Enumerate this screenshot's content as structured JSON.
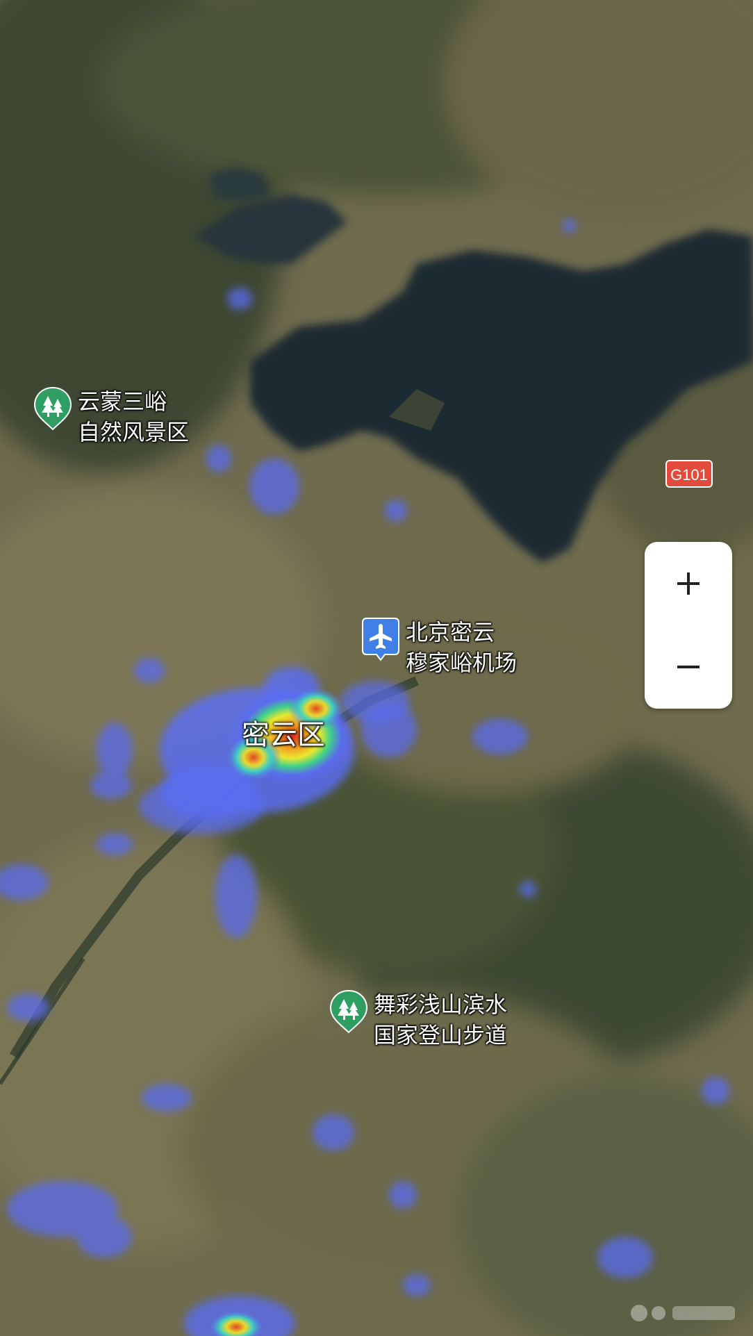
{
  "map": {
    "district_label": "密云区",
    "road_badge": "G101",
    "pois": [
      {
        "name": "scenic-area-yunmeng",
        "icon": "park-tree-icon",
        "lines": [
          "云蒙三峪",
          "自然风景区"
        ]
      },
      {
        "name": "airport-miyun",
        "icon": "airplane-icon",
        "lines": [
          "北京密云",
          "穆家峪机场"
        ]
      },
      {
        "name": "hiking-trail",
        "icon": "park-tree-icon",
        "lines": [
          "舞彩浅山滨水",
          "国家登山步道"
        ]
      }
    ]
  },
  "zoom": {
    "in_icon": "plus-icon",
    "out_icon": "minus-icon"
  },
  "colors": {
    "poi_green": "#2e9e63",
    "airport_blue": "#3f7fe6",
    "road_badge_red": "#e24a3b",
    "heat_low": "#5a6cf0",
    "heat_mid": "#3fd18a",
    "heat_high": "#e63a2a"
  }
}
